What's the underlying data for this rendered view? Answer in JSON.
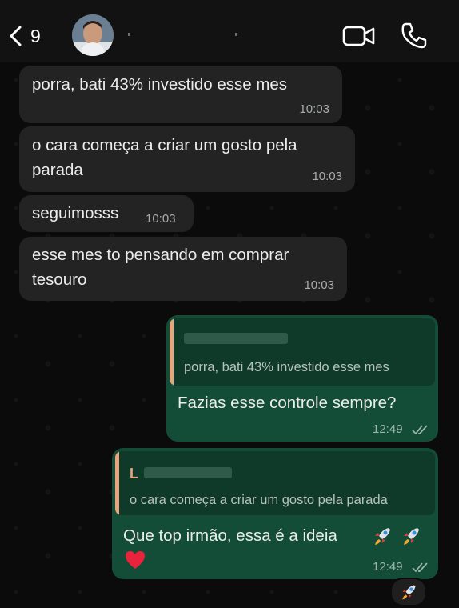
{
  "header": {
    "back_count": "9",
    "contact_name": "",
    "icons": {
      "back": "chevron-left-icon",
      "video": "video-call-icon",
      "voice": "phone-icon"
    }
  },
  "messages": [
    {
      "direction": "incoming",
      "text": "porra, bati 43% investido esse mes",
      "time": "10:03"
    },
    {
      "direction": "incoming",
      "text": "o cara começa a criar um gosto pela\nparada",
      "time": "10:03"
    },
    {
      "direction": "incoming",
      "text": "seguimosss",
      "time": "10:03"
    },
    {
      "direction": "incoming",
      "text": "esse mes to pensando em comprar\ntesouro",
      "time": "10:03"
    },
    {
      "direction": "outgoing",
      "quote_text": "porra, bati 43% investido esse mes",
      "text": "Fazias esse controle sempre?",
      "time": "12:49",
      "status": "read"
    },
    {
      "direction": "outgoing",
      "quote_author": "L",
      "quote_text": "o cara começa a criar um gosto pela parada",
      "text": "Que top irmão, essa é a ideia",
      "emojis": [
        "rocket",
        "rocket",
        "red-heart"
      ],
      "time": "12:49",
      "status": "read",
      "reaction": "rocket"
    }
  ],
  "colors": {
    "incoming_bubble": "#232323",
    "outgoing_bubble": "#144d37",
    "quote_accent": "#e6a57f"
  }
}
